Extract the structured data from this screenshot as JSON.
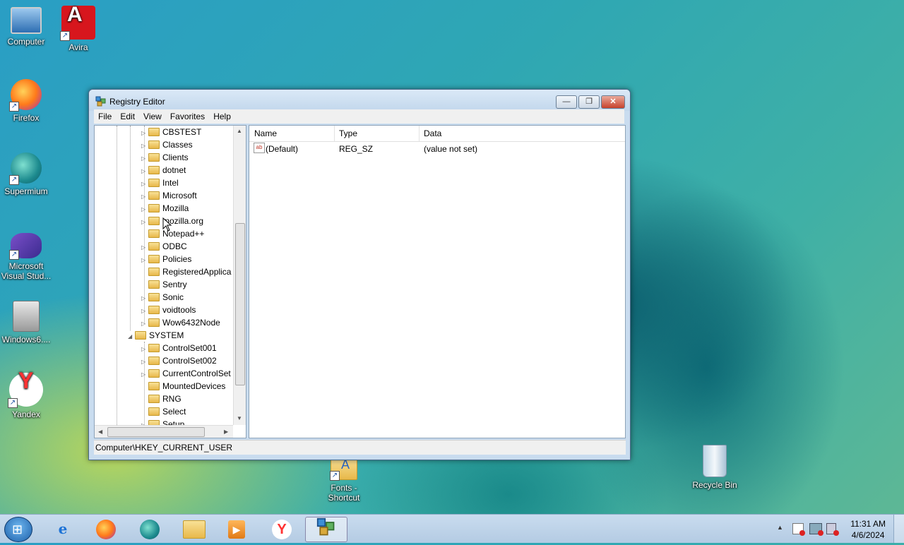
{
  "desktop": {
    "icons": [
      {
        "label": "Computer"
      },
      {
        "label": "Avira"
      },
      {
        "label": "Firefox"
      },
      {
        "label": "Supermium"
      },
      {
        "label": "Microsoft Visual Stud..."
      },
      {
        "label": "Windows6...."
      },
      {
        "label": "Yandex"
      },
      {
        "label": "Fonts - Shortcut"
      },
      {
        "label": "Recycle Bin"
      }
    ]
  },
  "window": {
    "title": "Registry Editor",
    "controls": {
      "minimize": "—",
      "restore": "❐",
      "close": "✕"
    },
    "menu": [
      "File",
      "Edit",
      "View",
      "Favorites",
      "Help"
    ],
    "tree": {
      "nodes": [
        {
          "label": "CBSTEST",
          "expander": "▷"
        },
        {
          "label": "Classes",
          "expander": "▷"
        },
        {
          "label": "Clients",
          "expander": "▷"
        },
        {
          "label": "dotnet",
          "expander": "▷"
        },
        {
          "label": "Intel",
          "expander": "▷"
        },
        {
          "label": "Microsoft",
          "expander": "▷"
        },
        {
          "label": "Mozilla",
          "expander": "▷"
        },
        {
          "label": "mozilla.org",
          "expander": "▷"
        },
        {
          "label": "Notepad++",
          "expander": ""
        },
        {
          "label": "ODBC",
          "expander": "▷"
        },
        {
          "label": "Policies",
          "expander": "▷"
        },
        {
          "label": "RegisteredApplica",
          "expander": ""
        },
        {
          "label": "Sentry",
          "expander": ""
        },
        {
          "label": "Sonic",
          "expander": "▷"
        },
        {
          "label": "voidtools",
          "expander": "▷"
        },
        {
          "label": "Wow6432Node",
          "expander": "▷"
        },
        {
          "label": "SYSTEM",
          "expander": "◢"
        },
        {
          "label": "ControlSet001",
          "expander": "▷"
        },
        {
          "label": "ControlSet002",
          "expander": "▷"
        },
        {
          "label": "CurrentControlSet",
          "expander": "▷"
        },
        {
          "label": "MountedDevices",
          "expander": ""
        },
        {
          "label": "RNG",
          "expander": ""
        },
        {
          "label": "Select",
          "expander": ""
        },
        {
          "label": "Setup",
          "expander": "▷"
        }
      ]
    },
    "list": {
      "columns": [
        "Name",
        "Type",
        "Data"
      ],
      "rows": [
        {
          "icon": "ab",
          "name": "(Default)",
          "type": "REG_SZ",
          "data": "(value not set)"
        }
      ]
    },
    "status": "Computer\\HKEY_CURRENT_USER"
  },
  "taskbar": {
    "time": "11:31 AM",
    "date": "4/6/2024",
    "tray_arrow": "▲"
  }
}
